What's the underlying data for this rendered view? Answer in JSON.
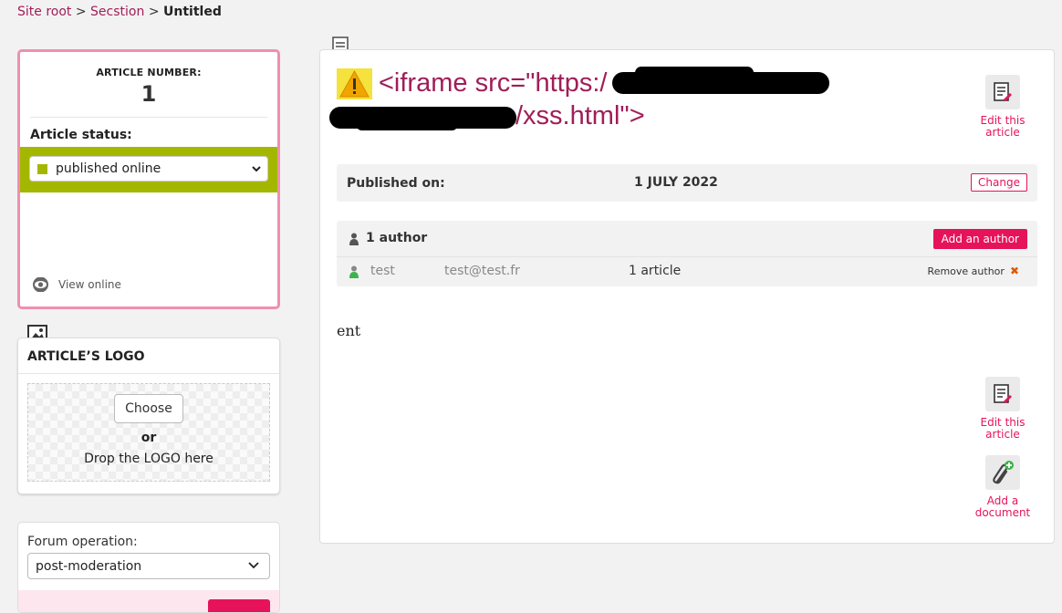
{
  "breadcrumb": {
    "root": "Site root",
    "section": "Secstion",
    "separator": ">",
    "current": "Untitled"
  },
  "article_box": {
    "number_label": "ARTICLE NUMBER:",
    "number": "1",
    "status_label": "Article status:",
    "status_value": "published online",
    "status_color": "#a4b700",
    "view_online": "View online"
  },
  "logo_panel": {
    "title": "ARTICLE’S LOGO",
    "choose": "Choose",
    "or": "or",
    "drop": "Drop the LOGO here"
  },
  "forum_panel": {
    "label": "Forum operation:",
    "value": "post-moderation"
  },
  "article": {
    "title_line1": "<iframe src=\"https:/",
    "title_line2": "/xss.html\">",
    "edit_top": "Edit this article",
    "published_label": "Published on:",
    "published_date": "1 JULY 2022",
    "change": "Change",
    "authors_title": "1 author",
    "add_author": "Add an author",
    "author": {
      "name": "test",
      "email": "test@test.fr",
      "articles": "1 article",
      "remove": "Remove author"
    },
    "body": "ent",
    "edit_bottom": "Edit this article",
    "add_document": "Add a document"
  },
  "colors": {
    "accent": "#e6135b",
    "link": "#a01e58",
    "warning": "#f5e23c",
    "box_border": "#ef8fb2"
  }
}
